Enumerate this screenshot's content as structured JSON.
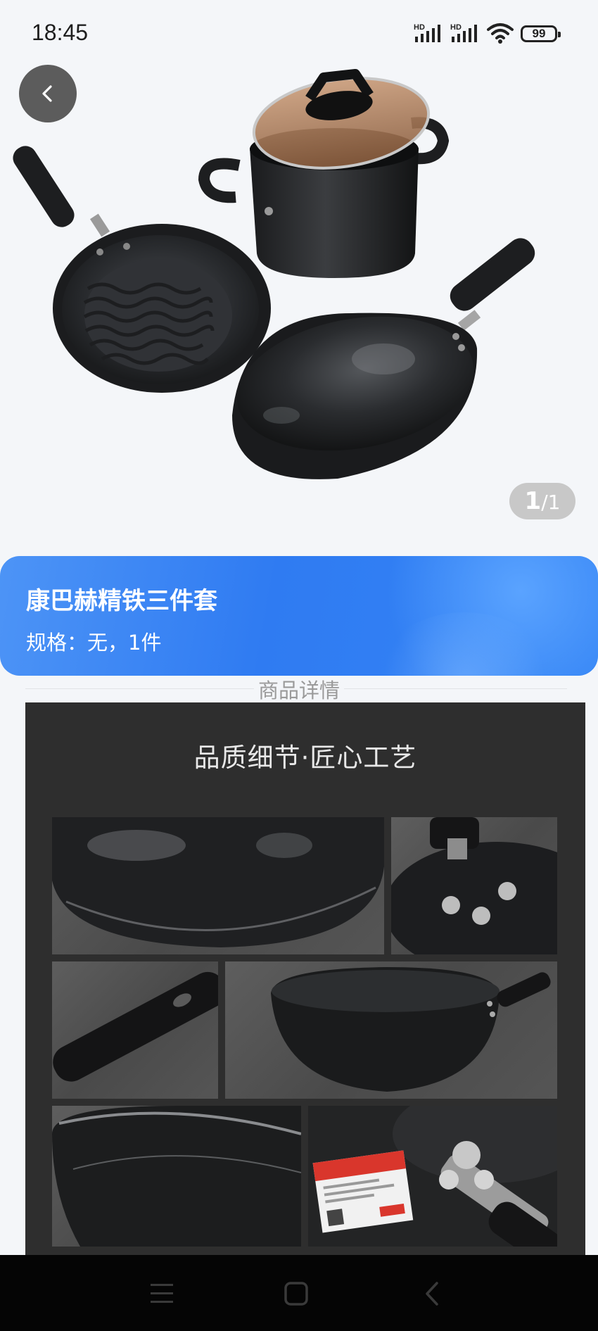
{
  "status_bar": {
    "time": "18:45",
    "signal1_label": "HD",
    "signal2_label": "HD",
    "battery": "99"
  },
  "gallery": {
    "current": "1",
    "total": "/1"
  },
  "product": {
    "title": "康巴赫精铁三件套",
    "spec_label": "规格：",
    "spec_value": "无，1件"
  },
  "detail": {
    "section_title": "商品详情",
    "image_heading": "品质细节·匠心工艺"
  },
  "icons": {
    "back": "chevron-left-icon",
    "menu": "menu-icon",
    "home": "square-icon",
    "nav_back": "triangle-back-icon"
  },
  "colors": {
    "accent": "#3585f5",
    "background": "#f4f6f9",
    "detail_bg": "#2e2e2e"
  }
}
